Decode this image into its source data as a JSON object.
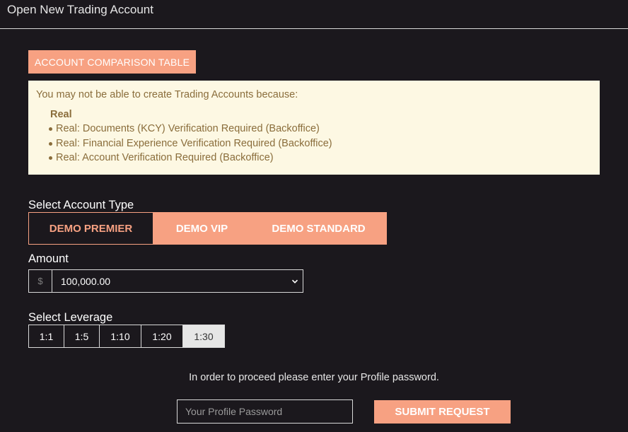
{
  "header": {
    "title": "Open New Trading Account"
  },
  "comparison_button": {
    "label": "ACCOUNT COMPARISON TABLE"
  },
  "notice": {
    "intro": "You may not be able to create Trading Accounts because:",
    "group": "Real",
    "items": [
      "Real: Documents (KCY) Verification Required (Backoffice)",
      "Real: Financial Experience Verification Required (Backoffice)",
      "Real: Account Verification Required (Backoffice)"
    ]
  },
  "account_type": {
    "label": "Select Account Type",
    "options": [
      "DEMO PREMIER",
      "DEMO VIP",
      "DEMO STANDARD"
    ],
    "selected": "DEMO PREMIER"
  },
  "amount": {
    "label": "Amount",
    "currency_symbol": "$",
    "value": "100,000.00"
  },
  "leverage": {
    "label": "Select Leverage",
    "options": [
      "1:1",
      "1:5",
      "1:10",
      "1:20",
      "1:30"
    ],
    "selected": "1:30"
  },
  "password": {
    "prompt": "In order to proceed please enter your Profile password.",
    "placeholder": "Your Profile Password"
  },
  "submit": {
    "label": "SUBMIT REQUEST"
  },
  "colors": {
    "background": "#1b181d",
    "accent": "#f7a182",
    "notice_bg": "#fdf8e3",
    "notice_text": "#8a6d3b"
  }
}
